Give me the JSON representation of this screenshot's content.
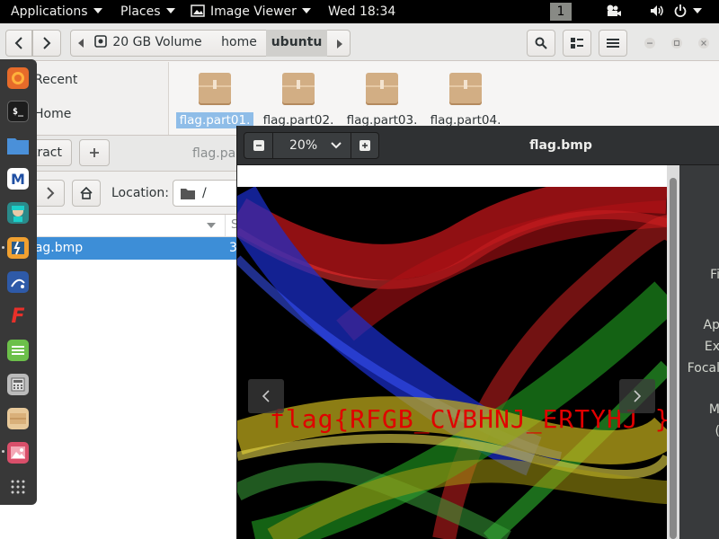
{
  "topbar": {
    "applications": "Applications",
    "places": "Places",
    "active_app": "Image Viewer",
    "clock": "Wed 18:34",
    "workspace": "1"
  },
  "files": {
    "path": [
      "20 GB Volume",
      "home",
      "ubuntu"
    ],
    "sidebar": [
      "Recent",
      "Home"
    ],
    "items": [
      "flag.part01.",
      "flag.part02.",
      "flag.part03.",
      "flag.part04."
    ]
  },
  "archive": {
    "extract_label": "Extract",
    "title": "flag.part",
    "location_label": "Location:",
    "location_value": "/",
    "size_header": "S",
    "row_name": "flag.bmp",
    "row_size": "3"
  },
  "viewer": {
    "zoom": "20%",
    "title": "flag.bmp",
    "image_text": "flag{RFGB_CVBHNJ_ERTYHJ }",
    "props": [
      "Fi",
      "Ap",
      "Ex",
      "Focal",
      "M",
      "("
    ]
  },
  "colors": {
    "selection": "#3d8ed7",
    "topbar_bg": "#000000",
    "viewer_bg": "#2f3133",
    "flag_text": "#e00000"
  }
}
